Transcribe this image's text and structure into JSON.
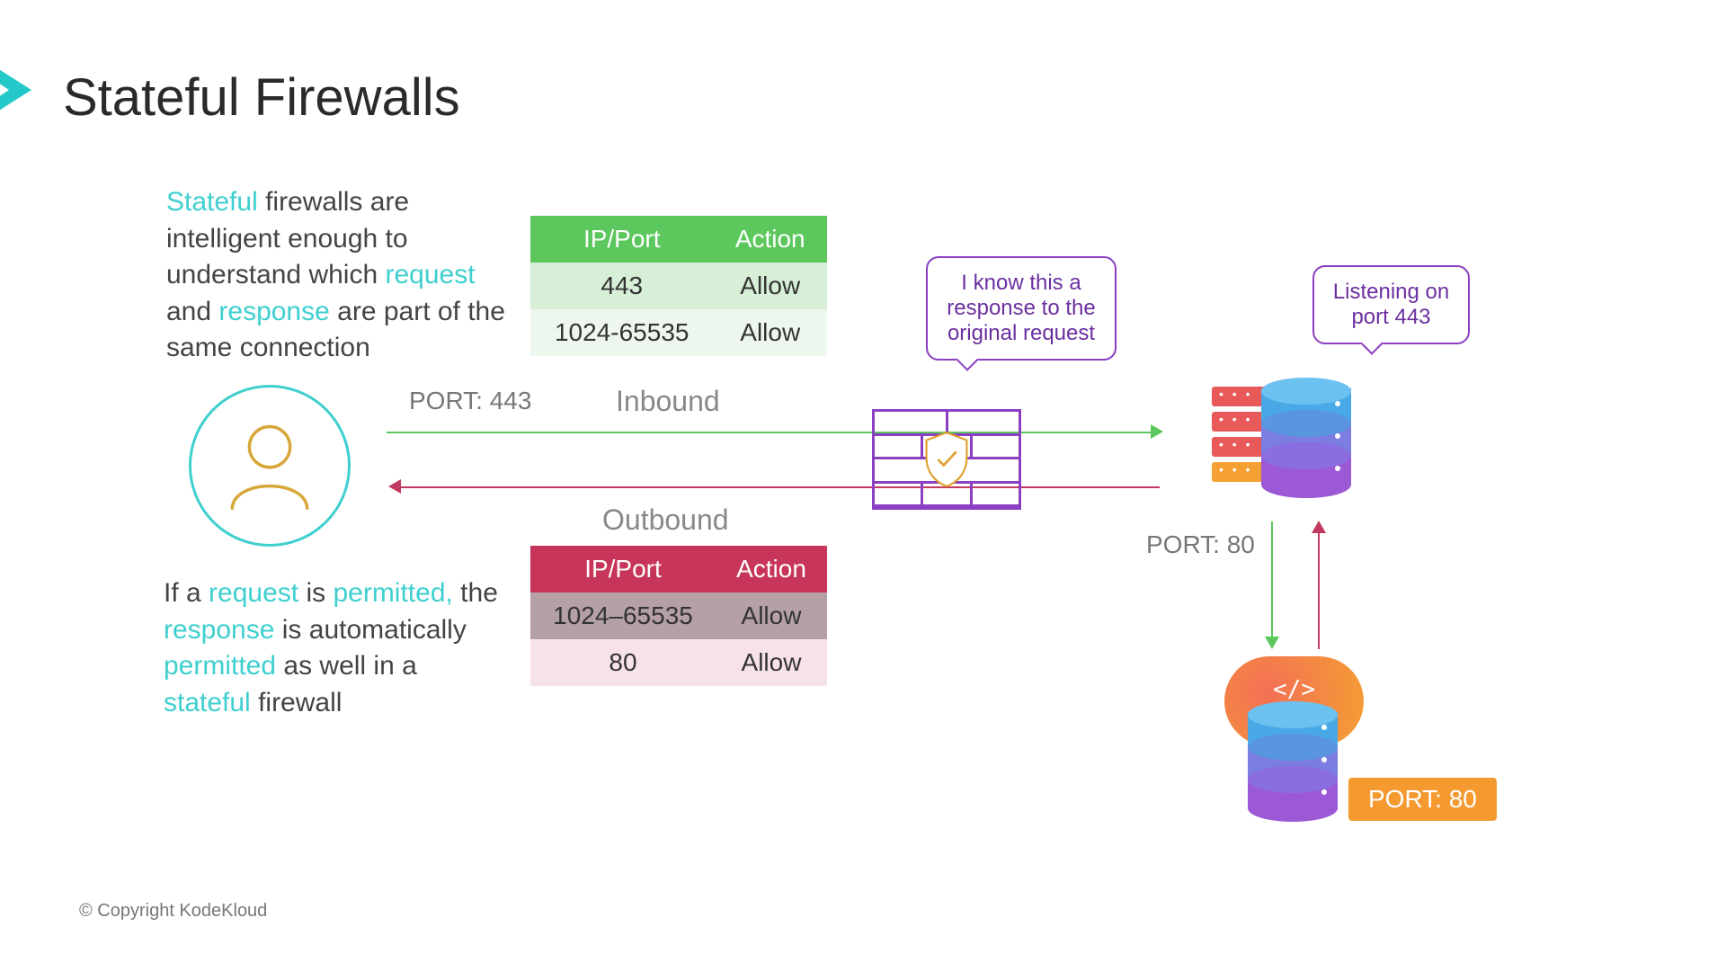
{
  "title": "Stateful Firewalls",
  "desc1": {
    "p1a": "Stateful",
    "p1b": " firewalls are intelligent enough to understand which ",
    "p1c": "request",
    "p1d": " and ",
    "p1e": "response",
    "p1f": " are part of the same connection"
  },
  "desc2": {
    "p2a": "If a ",
    "p2b": "request",
    "p2c": " is ",
    "p2d": "permitted,",
    "p2e": " the ",
    "p2f": "response",
    "p2g": " is automatically ",
    "p2h": "permitted",
    "p2i": " as well in a ",
    "p2j": "stateful",
    "p2k": " firewall"
  },
  "labels": {
    "inbound": "Inbound",
    "outbound": "Outbound",
    "port443": "PORT: 443",
    "port80side": "PORT: 80",
    "port80badge": "PORT: 80"
  },
  "table_inbound": {
    "h1": "IP/Port",
    "h2": "Action",
    "r1c1": "443",
    "r1c2": "Allow",
    "r2c1": "1024-65535",
    "r2c2": "Allow"
  },
  "table_outbound": {
    "h1": "IP/Port",
    "h2": "Action",
    "r1c1": "1024–65535",
    "r1c2": "Allow",
    "r2c1": "80",
    "r2c2": "Allow"
  },
  "bubble1": "I know this a response to the original request",
  "bubble2": "Listening on port 443",
  "copyright": "© Copyright KodeKloud"
}
